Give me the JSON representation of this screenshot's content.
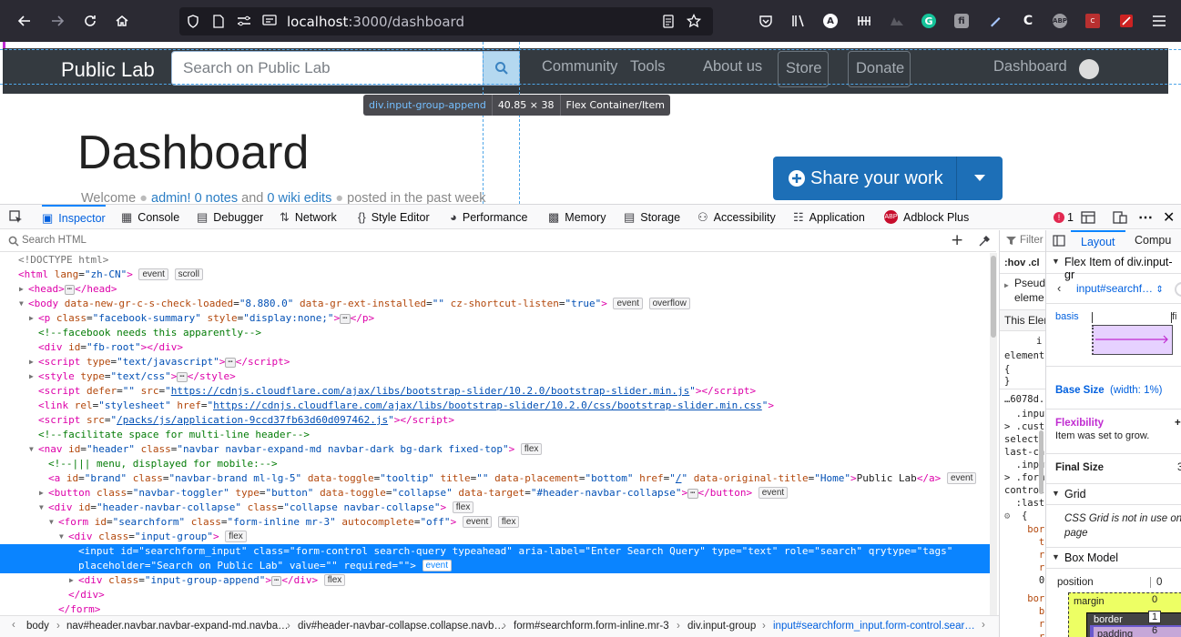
{
  "browser": {
    "url_host": "localhost",
    "url_path": ":3000/dashboard",
    "icons": [
      "back-arrow-icon",
      "forward-arrow-icon",
      "reload-icon",
      "home-icon",
      "shield-icon",
      "page-icon",
      "permissions-icon",
      "reader-view-icon",
      "reader-mode-icon",
      "bookmark-star-icon",
      "pocket-icon",
      "library-icon",
      "account-icon",
      "extension-icon",
      "extension-icon",
      "grammarly-icon",
      "extension-icon",
      "pen-icon",
      "extension-icon",
      "abp-icon",
      "extension-icon",
      "extension-icon",
      "menu-icon"
    ]
  },
  "site": {
    "brand": "Public Lab",
    "search_placeholder": "Search on Public Lab",
    "nav": [
      "Community",
      "Tools",
      "About us"
    ],
    "store": "Store",
    "donate": "Donate",
    "dashboard": "Dashboard",
    "page_title": "Dashboard",
    "welcome_prefix": "Welcome",
    "welcome_user": "admin!",
    "welcome_notes": "0 notes",
    "welcome_and": "and",
    "welcome_wikis": "0 wiki edits",
    "welcome_suffix": "posted in the past week",
    "share_button": "Share your work"
  },
  "tooltip": {
    "selector": "div.input-group-append",
    "size": "40.85 × 38",
    "kind": "Flex Container/Item"
  },
  "devtools": {
    "tabs": [
      "Inspector",
      "Console",
      "Debugger",
      "Network",
      "Style Editor",
      "Performance",
      "Memory",
      "Storage",
      "Accessibility",
      "Application",
      "Adblock Plus"
    ],
    "error_count": "1",
    "search_placeholder": "Search HTML",
    "breadcrumbs": [
      "body",
      "nav#header.navbar.navbar-expand-md.navba…",
      "div#header-navbar-collapse.collapse.navb…",
      "form#searchform.form-inline.mr-3",
      "div.input-group",
      "input#searchform_input.form-control.sear…"
    ],
    "styles": {
      "filter": "Filter",
      "hov": ":hov",
      "cls": ".cl",
      "pseudo1": "Pseud",
      "pseudo2": "eleme",
      "this_element": "This Elem",
      "lines": [
        "i",
        "element",
        "{",
        "}",
        "…6078d.",
        "  .input-",
        "> .cust",
        "select:",
        "last-ch",
        "  .input-",
        "> .form",
        "control",
        "  :last-c",
        "  {",
        "    bord",
        "      to",
        "      ri",
        "      ra",
        "      0;",
        "    bord",
        "      bo",
        "      ri",
        "      ra"
      ]
    },
    "layout": {
      "tabs": [
        "Layout",
        "Compu"
      ],
      "flex_item_header": "Flex Item of div.input-gr",
      "selected_element": "input#searchf…",
      "basis_label": "basis",
      "final_label": "fi",
      "base_size_label": "Base Size",
      "base_size_value": "(width: 1%)",
      "flexibility_label": "Flexibility",
      "flexibility_value": "+",
      "flex_note": "Item was set to grow.",
      "final_size_label": "Final Size",
      "final_size_value": "3",
      "grid_header": "Grid",
      "grid_note1": "CSS Grid is not in use on",
      "grid_note2": "page",
      "box_model_header": "Box Model",
      "position_label": "position",
      "position_value": "0",
      "margin_label": "margin",
      "margin_value": "0",
      "border_label": "border",
      "border_value": "1",
      "padding_label": "padding",
      "padding_value": "6"
    }
  }
}
